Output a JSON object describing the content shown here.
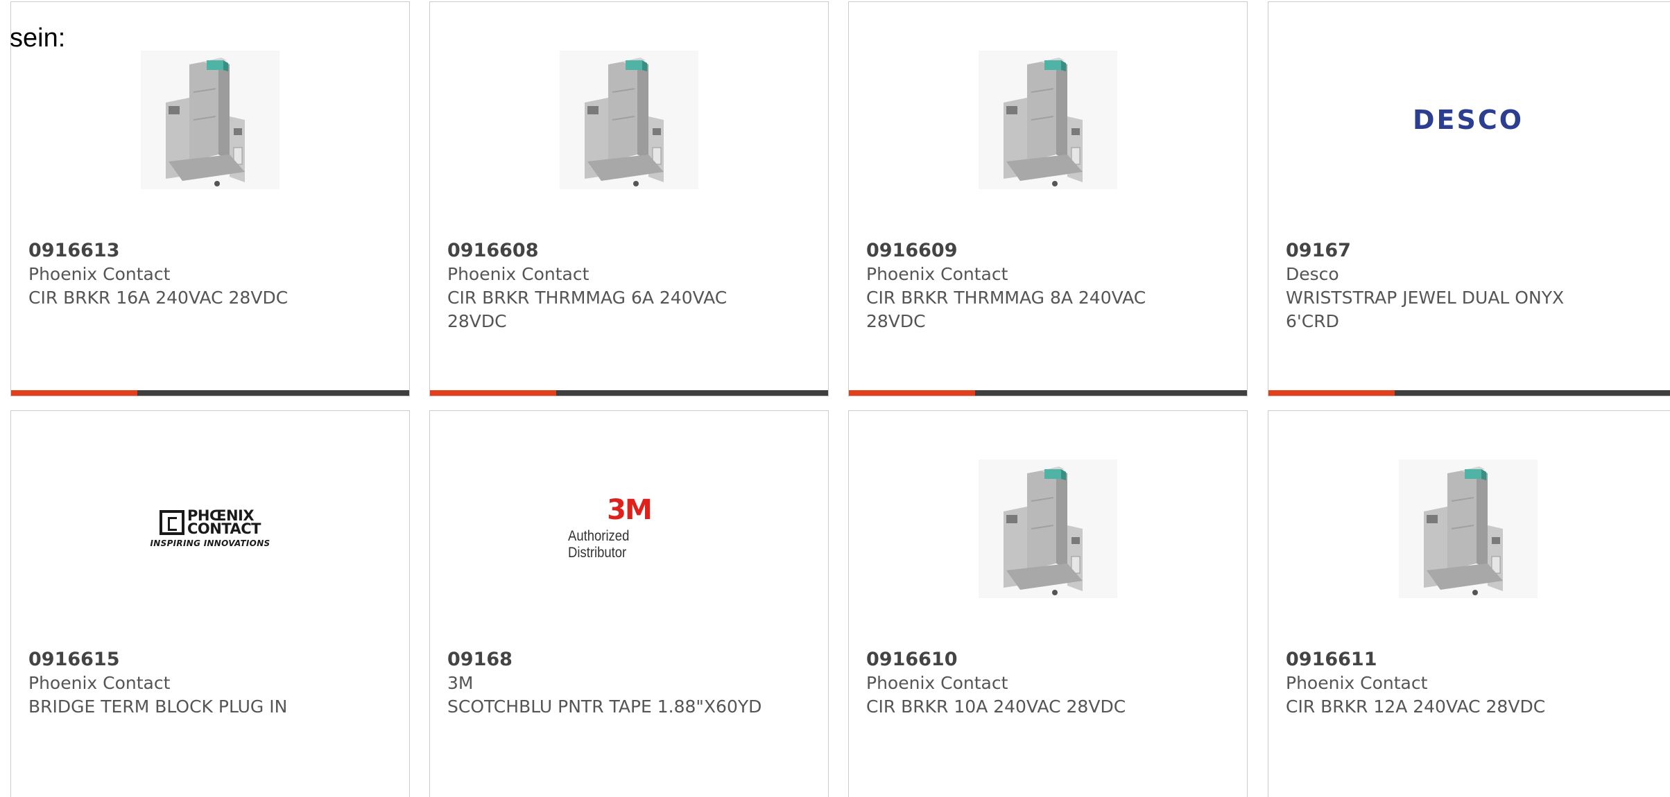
{
  "prefix_text": "sein:",
  "colors": {
    "accent_bar": "#e2401c",
    "dark_bar": "#3f3f3f",
    "desco_blue": "#2b3e8f",
    "mmm_red": "#e0201b"
  },
  "products": [
    {
      "sku": "0916613",
      "brand": "Phoenix Contact",
      "description": "CIR BRKR 16A 240VAC 28VDC",
      "image": "circuit-breaker-image"
    },
    {
      "sku": "0916608",
      "brand": "Phoenix Contact",
      "description": "CIR BRKR THRMMAG 6A 240VAC 28VDC",
      "image": "circuit-breaker-image"
    },
    {
      "sku": "0916609",
      "brand": "Phoenix Contact",
      "description": "CIR BRKR THRMMAG 8A 240VAC 28VDC",
      "image": "circuit-breaker-image"
    },
    {
      "sku": "09167",
      "brand": "Desco",
      "description": "WRISTSTRAP JEWEL DUAL ONYX 6'CRD",
      "image": "desco-logo",
      "logo_text": "DESCO"
    },
    {
      "sku": "0916615",
      "brand": "Phoenix Contact",
      "description": "BRIDGE TERM BLOCK PLUG IN",
      "image": "phoenix-contact-logo",
      "logo_line1": "PHŒNIX",
      "logo_line2": "CONTACT",
      "logo_tagline": "INSPIRING INNOVATIONS"
    },
    {
      "sku": "09168",
      "brand": "3M",
      "description": "SCOTCHBLU PNTR TAPE 1.88\"X60YD",
      "image": "3m-logo",
      "logo_mark": "3M",
      "logo_sub": "Authorized Distributor"
    },
    {
      "sku": "0916610",
      "brand": "Phoenix Contact",
      "description": "CIR BRKR 10A 240VAC 28VDC",
      "image": "circuit-breaker-image"
    },
    {
      "sku": "0916611",
      "brand": "Phoenix Contact",
      "description": "CIR BRKR 12A 240VAC 28VDC",
      "image": "circuit-breaker-image"
    }
  ]
}
